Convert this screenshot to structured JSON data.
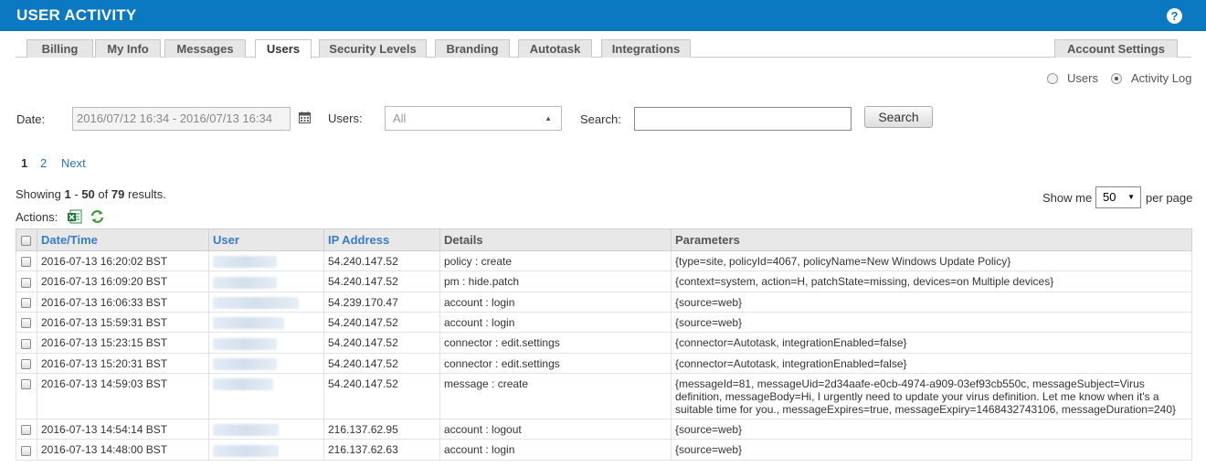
{
  "header": {
    "title": "USER ACTIVITY"
  },
  "tabs": [
    {
      "label": "Billing",
      "active": false
    },
    {
      "label": "My Info",
      "active": false
    },
    {
      "label": "Messages",
      "active": false
    },
    {
      "label": "Users",
      "active": true
    },
    {
      "label": "Security Levels",
      "active": false
    },
    {
      "label": "Branding",
      "active": false
    },
    {
      "label": "Autotask",
      "active": false
    },
    {
      "label": "Integrations",
      "active": false
    }
  ],
  "account_settings_tab": "Account Settings",
  "view_toggle": {
    "users": "Users",
    "activity_log": "Activity Log",
    "selected": "Activity Log"
  },
  "filters": {
    "date_label": "Date:",
    "date_value": "2016/07/12 16:34 - 2016/07/13 16:34",
    "users_label": "Users:",
    "users_value": "All",
    "search_label": "Search:",
    "search_value": "",
    "search_button": "Search"
  },
  "pagination": {
    "current": "1",
    "page2": "2",
    "next": "Next"
  },
  "results": {
    "prefix": "Showing",
    "from": "1",
    "sep": "-",
    "to": "50",
    "of": "of",
    "total": "79",
    "suffix": "results."
  },
  "page_size": {
    "label": "Show me",
    "value": "50",
    "suffix": "per page"
  },
  "actions": {
    "label": "Actions:"
  },
  "table": {
    "columns": [
      "Date/Time",
      "User",
      "IP Address",
      "Details",
      "Parameters"
    ],
    "rows": [
      {
        "datetime": "2016-07-13 16:20:02 BST",
        "ip": "54.240.147.52",
        "details": "policy : create",
        "params": "{type=site, policyId=4067, policyName=New Windows Update Policy}"
      },
      {
        "datetime": "2016-07-13 16:09:20 BST",
        "ip": "54.240.147.52",
        "details": "pm : hide.patch",
        "params": "{context=system, action=H, patchState=missing, devices=on Multiple devices}"
      },
      {
        "datetime": "2016-07-13 16:06:33 BST",
        "ip": "54.239.170.47",
        "details": "account : login",
        "params": "{source=web}"
      },
      {
        "datetime": "2016-07-13 15:59:31 BST",
        "ip": "54.240.147.52",
        "details": "account : login",
        "params": "{source=web}"
      },
      {
        "datetime": "2016-07-13 15:23:15 BST",
        "ip": "54.240.147.52",
        "details": "connector : edit.settings",
        "params": "{connector=Autotask, integrationEnabled=false}"
      },
      {
        "datetime": "2016-07-13 15:20:31 BST",
        "ip": "54.240.147.52",
        "details": "connector : edit.settings",
        "params": "{connector=Autotask, integrationEnabled=false}"
      },
      {
        "datetime": "2016-07-13 14:59:03 BST",
        "ip": "54.240.147.52",
        "details": "message : create",
        "params": "{messageId=81, messageUid=2d34aafe-e0cb-4974-a909-03ef93cb550c, messageSubject=Virus definition, messageBody=Hi, I urgently need to update your virus definition. Let me know when it's a suitable time for you., messageExpires=true, messageExpiry=1468432743106, messageDuration=240}"
      },
      {
        "datetime": "2016-07-13 14:54:14 BST",
        "ip": "216.137.62.95",
        "details": "account : logout",
        "params": "{source=web}"
      },
      {
        "datetime": "2016-07-13 14:48:00 BST",
        "ip": "216.137.62.63",
        "details": "account : login",
        "params": "{source=web}"
      }
    ]
  },
  "icons": {
    "help": "help-icon",
    "calendar": "calendar-icon",
    "excel": "excel-export-icon",
    "refresh": "refresh-icon"
  },
  "colors": {
    "header_bg": "#0b78c2",
    "link": "#2a74c4",
    "sort_header": "#3a7bc8"
  }
}
